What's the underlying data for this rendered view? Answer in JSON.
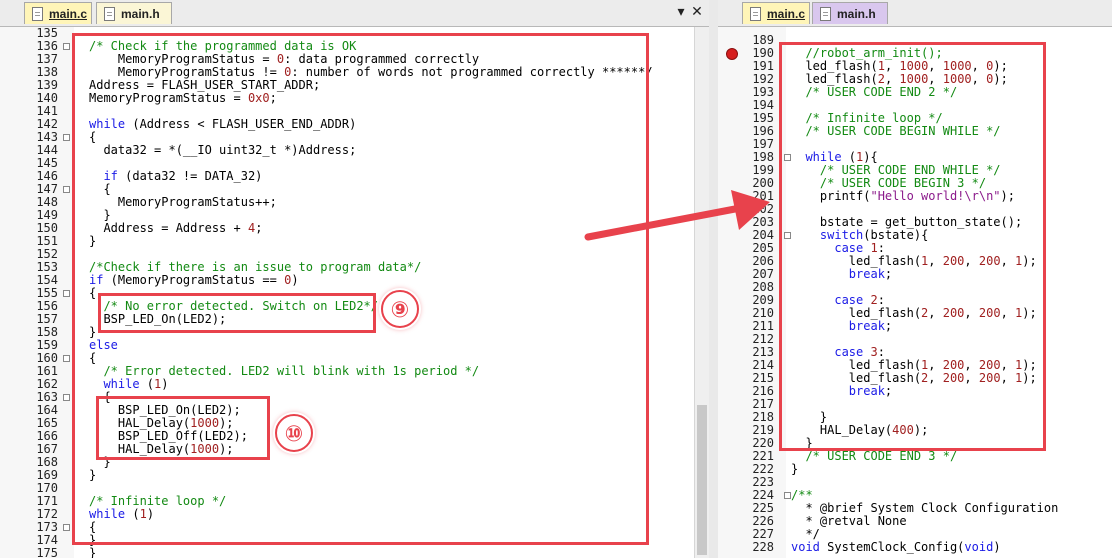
{
  "left_pane": {
    "tabs": [
      {
        "label": "main.c",
        "active": true
      },
      {
        "label": "main.h",
        "active": false
      }
    ],
    "window_controls": {
      "down": "▾",
      "close": "✕"
    },
    "lines": [
      {
        "num": "135",
        "code": ""
      },
      {
        "num": "136",
        "code": "/* Check if the programmed data is OK",
        "fold": true
      },
      {
        "num": "137",
        "code": "    MemoryProgramStatus = 0: data programmed correctly"
      },
      {
        "num": "138",
        "code": "    MemoryProgramStatus != 0: number of words not programmed correctly ******/"
      },
      {
        "num": "139",
        "code": "Address = FLASH_USER_START_ADDR;"
      },
      {
        "num": "140",
        "code": "MemoryProgramStatus = 0x0;"
      },
      {
        "num": "141",
        "code": ""
      },
      {
        "num": "142",
        "code": "while (Address < FLASH_USER_END_ADDR)"
      },
      {
        "num": "143",
        "code": "{",
        "fold": true
      },
      {
        "num": "144",
        "code": "  data32 = *(__IO uint32_t *)Address;"
      },
      {
        "num": "145",
        "code": ""
      },
      {
        "num": "146",
        "code": "  if (data32 != DATA_32)"
      },
      {
        "num": "147",
        "code": "  {",
        "fold": true
      },
      {
        "num": "148",
        "code": "    MemoryProgramStatus++;"
      },
      {
        "num": "149",
        "code": "  }"
      },
      {
        "num": "150",
        "code": "  Address = Address + 4;"
      },
      {
        "num": "151",
        "code": "}"
      },
      {
        "num": "152",
        "code": ""
      },
      {
        "num": "153",
        "code": "/*Check if there is an issue to program data*/"
      },
      {
        "num": "154",
        "code": "if (MemoryProgramStatus == 0)"
      },
      {
        "num": "155",
        "code": "{",
        "fold": true
      },
      {
        "num": "156",
        "code": "  /* No error detected. Switch on LED2*/"
      },
      {
        "num": "157",
        "code": "  BSP_LED_On(LED2);"
      },
      {
        "num": "158",
        "code": "}"
      },
      {
        "num": "159",
        "code": "else"
      },
      {
        "num": "160",
        "code": "{",
        "fold": true
      },
      {
        "num": "161",
        "code": "  /* Error detected. LED2 will blink with 1s period */"
      },
      {
        "num": "162",
        "code": "  while (1)"
      },
      {
        "num": "163",
        "code": "  {",
        "fold": true
      },
      {
        "num": "164",
        "code": "    BSP_LED_On(LED2);"
      },
      {
        "num": "165",
        "code": "    HAL_Delay(1000);"
      },
      {
        "num": "166",
        "code": "    BSP_LED_Off(LED2);"
      },
      {
        "num": "167",
        "code": "    HAL_Delay(1000);"
      },
      {
        "num": "168",
        "code": "  }"
      },
      {
        "num": "169",
        "code": "}"
      },
      {
        "num": "170",
        "code": ""
      },
      {
        "num": "171",
        "code": "/* Infinite loop */"
      },
      {
        "num": "172",
        "code": "while (1)"
      },
      {
        "num": "173",
        "code": "{",
        "fold": true
      },
      {
        "num": "174",
        "code": "}"
      },
      {
        "num": "175",
        "code": "}"
      }
    ],
    "annotations": [
      {
        "label": "⑨"
      },
      {
        "label": "⑩"
      }
    ]
  },
  "right_pane": {
    "tabs": [
      {
        "label": "main.c",
        "active": true
      },
      {
        "label": "main.h",
        "active": false
      }
    ],
    "lines": [
      {
        "num": "189",
        "code": ""
      },
      {
        "num": "190",
        "code": "  //robot_arm_init();",
        "breakpoint": true
      },
      {
        "num": "191",
        "code": "  led_flash(1, 1000, 1000, 0);"
      },
      {
        "num": "192",
        "code": "  led_flash(2, 1000, 1000, 0);"
      },
      {
        "num": "193",
        "code": "  /* USER CODE END 2 */"
      },
      {
        "num": "194",
        "code": ""
      },
      {
        "num": "195",
        "code": "  /* Infinite loop */"
      },
      {
        "num": "196",
        "code": "  /* USER CODE BEGIN WHILE */"
      },
      {
        "num": "197",
        "code": ""
      },
      {
        "num": "198",
        "code": "  while (1){",
        "fold": true
      },
      {
        "num": "199",
        "code": "    /* USER CODE END WHILE */"
      },
      {
        "num": "200",
        "code": "    /* USER CODE BEGIN 3 */"
      },
      {
        "num": "201",
        "code": "    printf(\"Hello world!\\r\\n\");"
      },
      {
        "num": "202",
        "code": ""
      },
      {
        "num": "203",
        "code": "    bstate = get_button_state();"
      },
      {
        "num": "204",
        "code": "    switch(bstate){",
        "fold": true
      },
      {
        "num": "205",
        "code": "      case 1:"
      },
      {
        "num": "206",
        "code": "        led_flash(1, 200, 200, 1);"
      },
      {
        "num": "207",
        "code": "        break;"
      },
      {
        "num": "208",
        "code": ""
      },
      {
        "num": "209",
        "code": "      case 2:"
      },
      {
        "num": "210",
        "code": "        led_flash(2, 200, 200, 1);"
      },
      {
        "num": "211",
        "code": "        break;"
      },
      {
        "num": "212",
        "code": ""
      },
      {
        "num": "213",
        "code": "      case 3:"
      },
      {
        "num": "214",
        "code": "        led_flash(1, 200, 200, 1);"
      },
      {
        "num": "215",
        "code": "        led_flash(2, 200, 200, 1);"
      },
      {
        "num": "216",
        "code": "        break;"
      },
      {
        "num": "217",
        "code": ""
      },
      {
        "num": "218",
        "code": "    }"
      },
      {
        "num": "219",
        "code": "    HAL_Delay(400);"
      },
      {
        "num": "220",
        "code": "  }"
      },
      {
        "num": "221",
        "code": "  /* USER CODE END 3 */"
      },
      {
        "num": "222",
        "code": "}"
      },
      {
        "num": "223",
        "code": ""
      },
      {
        "num": "224",
        "code": "/**",
        "fold": true
      },
      {
        "num": "225",
        "code": "  * @brief System Clock Configuration"
      },
      {
        "num": "226",
        "code": "  * @retval None"
      },
      {
        "num": "227",
        "code": "  */"
      },
      {
        "num": "228",
        "code": "void SystemClock_Config(void)"
      }
    ]
  },
  "colors": {
    "annotation_red": "#e8424c",
    "keyword": "#1a1ae6",
    "comment": "#138a13",
    "number": "#a02020",
    "string": "#8b1a8b",
    "active_tab": "#fff5b8",
    "inactive_tab_left": "#fbf6d6",
    "inactive_tab_right": "#d9c7ee"
  }
}
